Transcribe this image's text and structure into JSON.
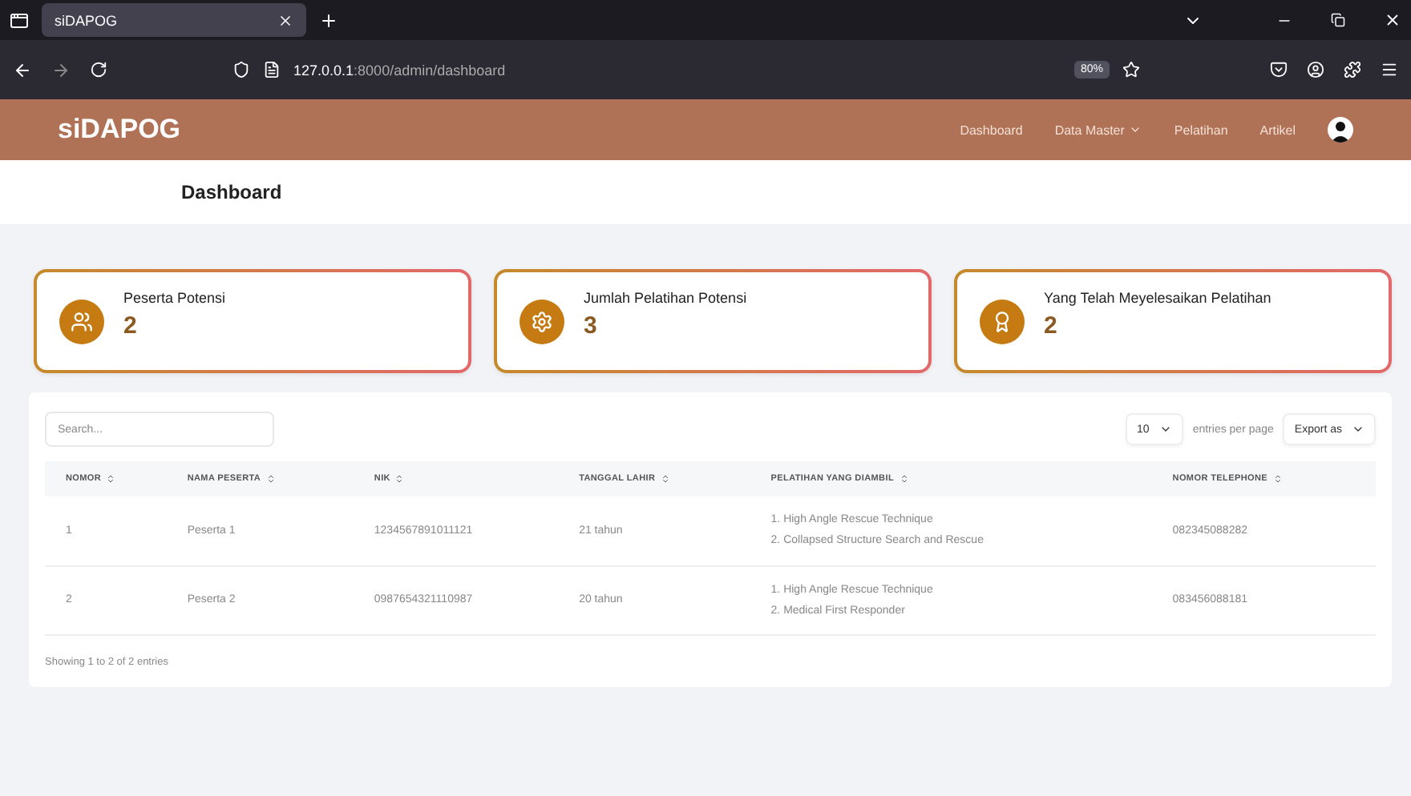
{
  "browser": {
    "tab_title": "siDAPOG",
    "url_host": "127.0.0.1",
    "url_rest": ":8000/admin/dashboard",
    "zoom": "80%"
  },
  "navbar": {
    "brand": "siDAPOG",
    "links": [
      {
        "label": "Dashboard",
        "dropdown": false
      },
      {
        "label": "Data Master",
        "dropdown": true
      },
      {
        "label": "Pelatihan",
        "dropdown": false
      },
      {
        "label": "Artikel",
        "dropdown": false
      }
    ]
  },
  "page_title": "Dashboard",
  "stats": [
    {
      "kind": "people",
      "label": "Peserta Potensi",
      "value": "2"
    },
    {
      "kind": "gear",
      "label": "Jumlah Pelatihan Potensi",
      "value": "3"
    },
    {
      "kind": "award",
      "label": "Yang Telah Meyelesaikan Pelatihan",
      "value": "2"
    }
  ],
  "table": {
    "search": {
      "placeholder": "Search..."
    },
    "per_page": "10",
    "per_page_label": "entries per page",
    "export": "Export as",
    "columns": [
      "NOMOR",
      "NAMA PESERTA",
      "NIK",
      "TANGGAL LAHIR",
      "PELATIHAN YANG DIAMBIL",
      "NOMOR TELEPHONE"
    ],
    "rows": [
      {
        "nomor": "1",
        "nama": "Peserta 1",
        "nik": "1234567891011121",
        "tanggal_lahir": "21 tahun",
        "pelatihan": [
          "1. High Angle Rescue Technique",
          "2. Collapsed Structure Search and Rescue"
        ],
        "telephone": "082345088282"
      },
      {
        "nomor": "2",
        "nama": "Peserta 2",
        "nik": "0987654321110987",
        "tanggal_lahir": "20 tahun",
        "pelatihan": [
          "1. High Angle Rescue Technique",
          "2. Medical First Responder"
        ],
        "telephone": "083456088181"
      }
    ],
    "footer": "Showing 1 to 2 of 2 entries"
  }
}
